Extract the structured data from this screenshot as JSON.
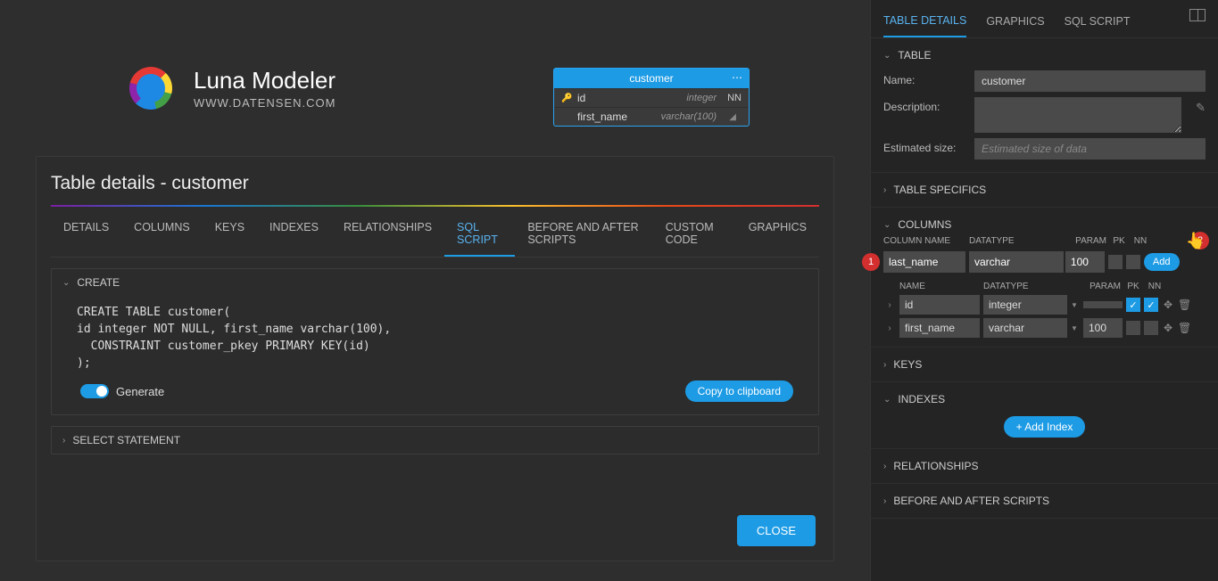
{
  "brand": {
    "title": "Luna Modeler",
    "subtitle": "WWW.DATENSEN.COM"
  },
  "diagram": {
    "table_name": "customer",
    "rows": [
      {
        "key": "🔑",
        "name": "id",
        "type": "integer",
        "nn": "NN"
      },
      {
        "key": "",
        "name": "first_name",
        "type": "varchar(100)",
        "nn": ""
      }
    ]
  },
  "panel": {
    "title": "Table details - customer",
    "tabs": [
      "DETAILS",
      "COLUMNS",
      "KEYS",
      "INDEXES",
      "RELATIONSHIPS",
      "SQL SCRIPT",
      "BEFORE AND AFTER SCRIPTS",
      "CUSTOM CODE",
      "GRAPHICS"
    ],
    "active_tab": "SQL SCRIPT",
    "create_label": "CREATE",
    "sql": "CREATE TABLE customer(\nid integer NOT NULL, first_name varchar(100),\n  CONSTRAINT customer_pkey PRIMARY KEY(id)\n);",
    "generate_label": "Generate",
    "copy_label": "Copy to clipboard",
    "select_label": "SELECT STATEMENT",
    "close_label": "CLOSE"
  },
  "sidebar": {
    "tabs": [
      "TABLE DETAILS",
      "GRAPHICS",
      "SQL SCRIPT"
    ],
    "active_tab": "TABLE DETAILS",
    "sections": {
      "table": "TABLE",
      "name_label": "Name:",
      "name_value": "customer",
      "desc_label": "Description:",
      "est_label": "Estimated size:",
      "est_placeholder": "Estimated size of data",
      "specifics": "TABLE SPECIFICS",
      "columns": "COLUMNS",
      "keys": "KEYS",
      "indexes": "INDEXES",
      "relationships": "RELATIONSHIPS",
      "before_after": "BEFORE AND AFTER SCRIPTS"
    },
    "new_col_headers": {
      "name": "COLUMN NAME",
      "type": "DATATYPE",
      "param": "PARAM",
      "pk": "PK",
      "nn": "NN"
    },
    "new_col": {
      "name": "last_name",
      "type": "varchar",
      "param": "100",
      "add_label": "Add"
    },
    "list_headers": {
      "name": "NAME",
      "type": "DATATYPE",
      "param": "PARAM",
      "pk": "PK",
      "nn": "NN"
    },
    "columns_list": [
      {
        "name": "id",
        "type": "integer",
        "param": "",
        "pk": true,
        "nn": true
      },
      {
        "name": "first_name",
        "type": "varchar",
        "param": "100",
        "pk": false,
        "nn": false
      }
    ],
    "add_index_label": "+ Add Index",
    "badges": {
      "one": "1",
      "two": "2"
    }
  }
}
